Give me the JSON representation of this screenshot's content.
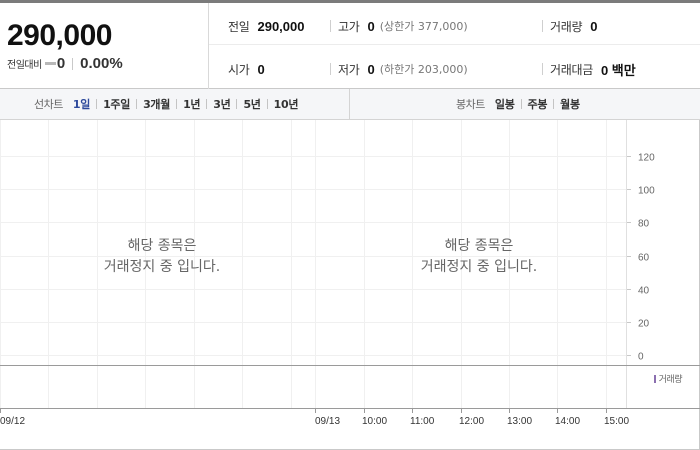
{
  "summary": {
    "current_price": "290,000",
    "change_label": "전일대비",
    "change_value": "0",
    "change_rate": "0.00%",
    "items": [
      {
        "label": "전일",
        "value": "290,000",
        "sub": ""
      },
      {
        "label": "고가",
        "value": "0",
        "sub": "(상한가 377,000)"
      },
      {
        "label": "거래량",
        "value": "0",
        "sub": ""
      },
      {
        "label": "시가",
        "value": "0",
        "sub": ""
      },
      {
        "label": "저가",
        "value": "0",
        "sub": "(하한가 203,000)"
      },
      {
        "label": "거래대금",
        "value": "0 백만",
        "sub": ""
      }
    ]
  },
  "period_tabs": {
    "line_chart_title": "선차트",
    "line_chart_periods": [
      "1일",
      "1주일",
      "3개월",
      "1년",
      "3년",
      "5년",
      "10년"
    ],
    "active_period": "1일",
    "candle_chart_title": "봉차트",
    "candle_chart_periods": [
      "일봉",
      "주봉",
      "월봉"
    ]
  },
  "messages": {
    "suspended_line1": "해당 종목은",
    "suspended_line2": "거래정지 중 입니다."
  },
  "volume_legend": "거래량",
  "colors": {
    "active_tab": "#2e4a9c",
    "volume_swatch": "#8b6fb0",
    "grid": "#f0f0f0"
  },
  "chart_data": {
    "type": "line",
    "series": [],
    "y_ticks": [
      0,
      20,
      40,
      60,
      80,
      100,
      120
    ],
    "ylim": [
      0,
      120
    ],
    "x_tick_labels": [
      "09/12",
      "09/13",
      "10:00",
      "11:00",
      "12:00",
      "13:00",
      "14:00",
      "15:00"
    ],
    "grid": true,
    "legend": "거래량"
  }
}
